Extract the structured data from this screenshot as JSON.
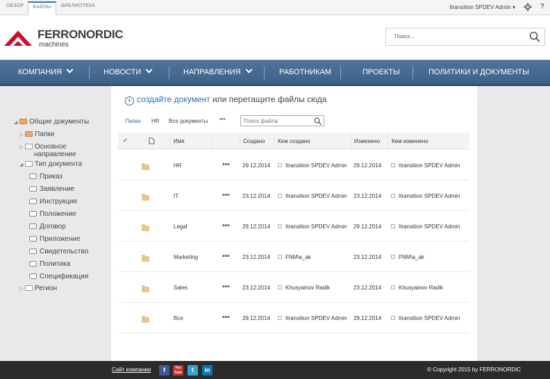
{
  "ribbon": {
    "tabs": [
      "ОБЗОР",
      "ФАЙЛЫ",
      "БИБЛИОТЕКА"
    ],
    "user": "Itransition SPDEV Admin",
    "help": "?"
  },
  "logo": {
    "brand": "FERRONORDIC",
    "sub": "machines"
  },
  "search": {
    "placeholder": "Поиск..."
  },
  "nav": {
    "items": [
      {
        "label": "КОМПАНИЯ"
      },
      {
        "label": "НОВОСТИ"
      },
      {
        "label": "НАПРАВЛЕНИЯ"
      },
      {
        "label": "РАБОТНИКАМ"
      },
      {
        "label": "ПРОЕКТЫ"
      },
      {
        "label": "ПОЛИТИКИ И ДОКУМЕНТЫ"
      }
    ]
  },
  "tree": {
    "root": "Общие документы",
    "folders": "Папки",
    "direction": [
      "Основное",
      "направление"
    ],
    "doctype": "Тип документа",
    "types": [
      "Приказ",
      "Заявление",
      "Инструкция",
      "Положение",
      "Договор",
      "Приложение",
      "Свидетельство",
      "Политика",
      "Спецификация"
    ],
    "region": "Регион"
  },
  "create": {
    "link": "создайте документ",
    "rest": " или перетащите файлы сюда"
  },
  "views": {
    "items": [
      "Папки",
      "HR",
      "Все документы"
    ],
    "more": "•••"
  },
  "file_search": {
    "placeholder": "Поиск файла"
  },
  "table": {
    "headers": {
      "check": "✓",
      "name": "Имя",
      "created": "Создано",
      "created_by": "Кем создано",
      "modified": "Изменено",
      "modified_by": "Кем изменено"
    },
    "rows": [
      {
        "name": "HR",
        "created": "29.12.2014",
        "created_by": "Itransition SPDEV Admin",
        "modified": "29.12.2014",
        "modified_by": "Itransition SPDEV Admin"
      },
      {
        "name": "IT",
        "created": "23.12.2014",
        "created_by": "Itransition SPDEV Admin",
        "modified": "23.12.2014",
        "modified_by": "Itransition SPDEV Admin"
      },
      {
        "name": "Legal",
        "created": "29.12.2014",
        "created_by": "Itransition SPDEV Admin",
        "modified": "29.12.2014",
        "modified_by": "Itransition SPDEV Admin"
      },
      {
        "name": "Marketing",
        "created": "23.12.2014",
        "created_by": "FNM\\a_ak",
        "modified": "23.12.2014",
        "modified_by": "FNM\\a_ak"
      },
      {
        "name": "Sales",
        "created": "23.12.2014",
        "created_by": "Khusyainov Radik",
        "modified": "23.12.2014",
        "modified_by": "Khusyainov Radik"
      },
      {
        "name": "Все",
        "created": "29.12.2014",
        "created_by": "Itransition SPDEV Admin",
        "modified": "29.12.2014",
        "modified_by": "Itransition SPDEV Admin"
      }
    ],
    "row_menu": "•••"
  },
  "footer": {
    "site_link": "Сайт компании",
    "social": [
      "f",
      "You Tube",
      "t",
      "in"
    ],
    "copyright": "© Copyright 2015 by FERRONORDIC"
  },
  "colors": {
    "nav": "#3d6289",
    "accent": "#2a6db5",
    "footer": "#2b2b2b",
    "logo_red": "#c8102e"
  }
}
